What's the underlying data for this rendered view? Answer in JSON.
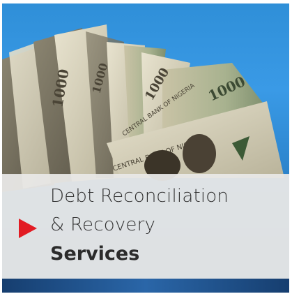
{
  "card": {
    "photo": {
      "description_icon": "naira-banknotes-fan-image",
      "banknote_denomination": "1000",
      "banknote_issuer_text": "CENTRAL BANK OF NIGERIA",
      "banknote_country_text": "NIGERIA"
    },
    "caption": {
      "line1": "Debt Reconciliation",
      "line2": "& Recovery",
      "line3": "Services",
      "arrow_icon": "play-arrow-icon",
      "arrow_color": "#e21b23",
      "text_color": "#333333",
      "panel_color": "#ececec"
    }
  }
}
